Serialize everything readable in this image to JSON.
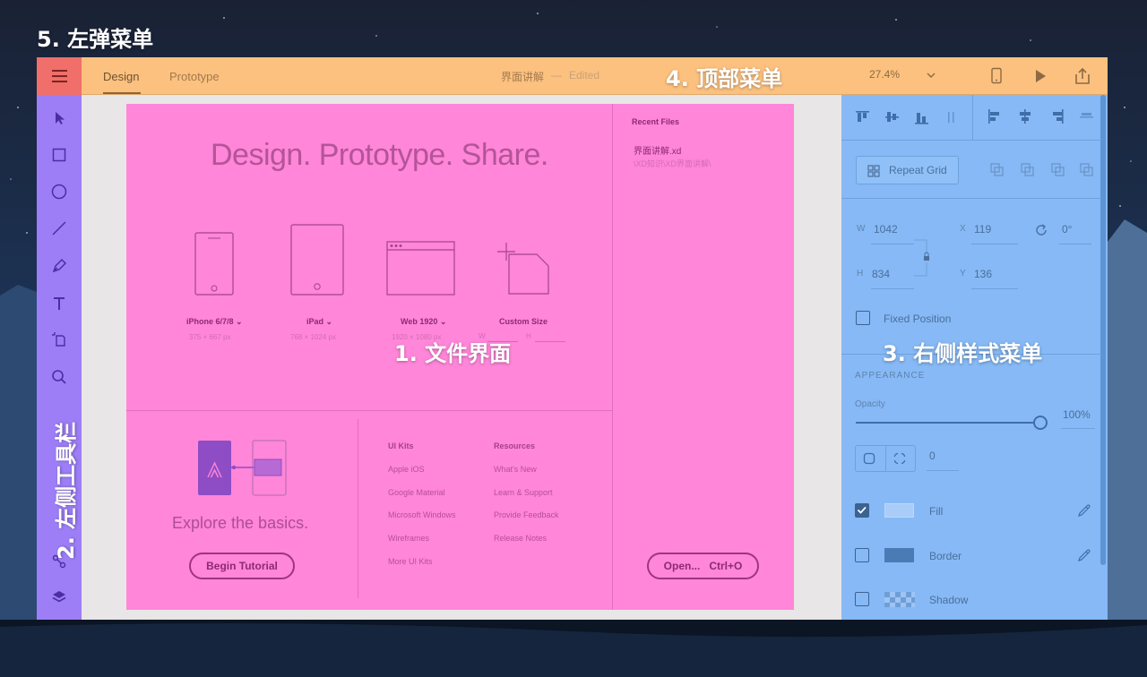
{
  "annotations": {
    "left_popup_menu": "5. 左弹菜单",
    "top_menu": "4. 顶部菜单",
    "file_interface": "1. 文件界面",
    "right_style_menu": "3. 右侧样式菜单",
    "left_toolbar": "2. 左侧工具栏"
  },
  "colors": {
    "top_menu": "#fcc17f",
    "hamburger": "#f06f6a",
    "left_toolbar": "#9d7ef7",
    "file_interface": "#ff86d9",
    "right_panel": "#86b9f5"
  },
  "header": {
    "tabs": [
      "Design",
      "Prototype"
    ],
    "doc_title": "界面讲解",
    "separator": "—",
    "doc_status": "Edited",
    "zoom": "27.4%",
    "icons": [
      "hamburger-menu-icon",
      "chevron-down-icon",
      "mobile-preview-icon",
      "play-icon",
      "share-icon"
    ]
  },
  "toolbar": {
    "tools": [
      "select-arrow-icon",
      "rectangle-icon",
      "ellipse-icon",
      "line-icon",
      "pen-icon",
      "text-icon",
      "artboard-icon",
      "zoom-icon",
      "symbols-icon",
      "layers-icon"
    ]
  },
  "home": {
    "headline": "Design. Prototype. Share.",
    "presets": [
      {
        "name": "iPhone 6/7/8",
        "size": "375 × 667 px"
      },
      {
        "name": "iPad",
        "size": "768 × 1024 px"
      },
      {
        "name": "Web 1920",
        "size": "1920 × 1080 px"
      },
      {
        "name": "Custom Size",
        "w_label": "W",
        "h_label": "H"
      }
    ],
    "recent_title": "Recent Files",
    "recent_file_name": "界面讲解.xd",
    "recent_file_path": "\\XD知识\\XD界面讲解\\",
    "explore_text": "Explore the basics.",
    "begin_tutorial": "Begin Tutorial",
    "ui_kits_title": "UI Kits",
    "ui_kits": [
      "Apple iOS",
      "Google Material",
      "Microsoft Windows",
      "Wireframes",
      "More UI Kits"
    ],
    "resources_title": "Resources",
    "resources": [
      "What's New",
      "Learn & Support",
      "Provide Feedback",
      "Release Notes"
    ],
    "open_button": "Open...   Ctrl+O"
  },
  "inspector": {
    "repeat_grid": "Repeat Grid",
    "w_label": "W",
    "w_value": "1042",
    "x_label": "X",
    "x_value": "119",
    "h_label": "H",
    "h_value": "834",
    "y_label": "Y",
    "y_value": "136",
    "rotation": "0°",
    "fixed_position": "Fixed Position",
    "appearance": "APPEARANCE",
    "opacity_label": "Opacity",
    "opacity_value": "100%",
    "opacity_fraction": 1.0,
    "corner_radius": "0",
    "fill_label": "Fill",
    "fill_checked": true,
    "border_label": "Border",
    "border_checked": false,
    "shadow_label": "Shadow",
    "shadow_checked": false
  }
}
